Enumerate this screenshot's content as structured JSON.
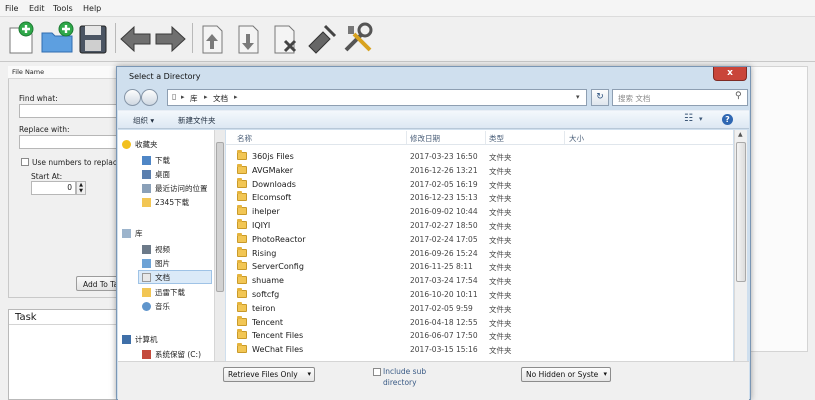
{
  "menu": [
    "File",
    "Edit",
    "Tools",
    "Help"
  ],
  "toolbar_icons": [
    "new-file-icon",
    "open-folder-icon",
    "save-icon",
    "back-arrow-icon",
    "forward-arrow-icon",
    "document-upload-icon",
    "document-download-icon",
    "document-delete-icon",
    "clear-icon",
    "tools-icon"
  ],
  "left_panel": {
    "file_name_header": "File Name",
    "find_label": "Find what:",
    "replace_label": "Replace with:",
    "numbers_label": "Use numbers to replace #",
    "start_label": "Start At:",
    "start_value": "0",
    "add_button": "Add To Ta"
  },
  "task": {
    "title": "Task"
  },
  "dialog": {
    "title": "Select a Directory",
    "close": "x",
    "address": [
      "库",
      "文档"
    ],
    "search_placeholder": "搜索 文档",
    "organize": "组织 ▾",
    "new_folder": "新建文件夹",
    "nav": {
      "favorites_header": "收藏夹",
      "favorites": [
        "下载",
        "桌面",
        "最近访问的位置",
        "2345下载"
      ],
      "libraries_header": "库",
      "libraries": [
        "视频",
        "图片",
        "文档",
        "迅雷下载",
        "音乐"
      ],
      "computer_header": "计算机",
      "computer": [
        "系统保留 (C:)"
      ]
    },
    "columns": {
      "name": "名称",
      "date": "修改日期",
      "type": "类型",
      "size": "大小"
    },
    "files": [
      {
        "name": "360js Files",
        "date": "2017-03-23 16:50",
        "type": "文件夹"
      },
      {
        "name": "AVGMaker",
        "date": "2016-12-26 13:21",
        "type": "文件夹"
      },
      {
        "name": "Downloads",
        "date": "2017-02-05 16:19",
        "type": "文件夹"
      },
      {
        "name": "Elcomsoft",
        "date": "2016-12-23 15:13",
        "type": "文件夹"
      },
      {
        "name": "ihelper",
        "date": "2016-09-02 10:44",
        "type": "文件夹"
      },
      {
        "name": "IQIYI",
        "date": "2017-02-27 18:50",
        "type": "文件夹"
      },
      {
        "name": "PhotoReactor",
        "date": "2017-02-24 17:05",
        "type": "文件夹"
      },
      {
        "name": "Rising",
        "date": "2016-09-26 15:24",
        "type": "文件夹"
      },
      {
        "name": "ServerConfig",
        "date": "2016-11-25 8:11",
        "type": "文件夹"
      },
      {
        "name": "shuame",
        "date": "2017-03-24 17:54",
        "type": "文件夹"
      },
      {
        "name": "softcfg",
        "date": "2016-10-20 10:11",
        "type": "文件夹"
      },
      {
        "name": "teiron",
        "date": "2017-02-05 9:59",
        "type": "文件夹"
      },
      {
        "name": "Tencent",
        "date": "2016-04-18 12:55",
        "type": "文件夹"
      },
      {
        "name": "Tencent Files",
        "date": "2016-06-07 17:50",
        "type": "文件夹"
      },
      {
        "name": "WeChat Files",
        "date": "2017-03-15 15:16",
        "type": "文件夹"
      }
    ],
    "retrieve_option": "Retrieve Files Only",
    "include_sub": "Include sub",
    "include_sub2": "directory",
    "hidden_option": "No Hidden or Syste"
  }
}
